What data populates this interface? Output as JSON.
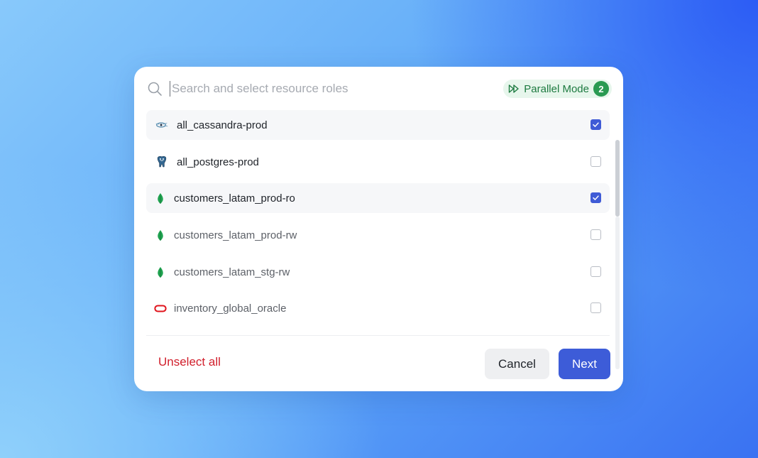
{
  "search": {
    "placeholder": "Search and select resource roles",
    "value": ""
  },
  "parallel_mode": {
    "label": "Parallel Mode",
    "count": "2"
  },
  "items": [
    {
      "label": "all_cassandra-prod",
      "icon": "cassandra-icon",
      "checked": true
    },
    {
      "label": "all_postgres-prod",
      "icon": "postgres-icon",
      "checked": false
    },
    {
      "label": "customers_latam_prod-ro",
      "icon": "mongodb-icon",
      "checked": true
    },
    {
      "label": "customers_latam_prod-rw",
      "icon": "mongodb-icon",
      "checked": false
    },
    {
      "label": "customers_latam_stg-rw",
      "icon": "mongodb-icon",
      "checked": false
    },
    {
      "label": "inventory_global_oracle",
      "icon": "oracle-icon",
      "checked": false
    }
  ],
  "footer": {
    "unselect_label": "Unselect all",
    "cancel_label": "Cancel",
    "next_label": "Next"
  },
  "colors": {
    "accent": "#3d5cd8",
    "danger": "#d11f2c",
    "badge_bg": "#e7f6ec",
    "badge_text": "#1d7a40",
    "mongodb_green": "#1fa350",
    "oracle_red": "#e0141c"
  }
}
